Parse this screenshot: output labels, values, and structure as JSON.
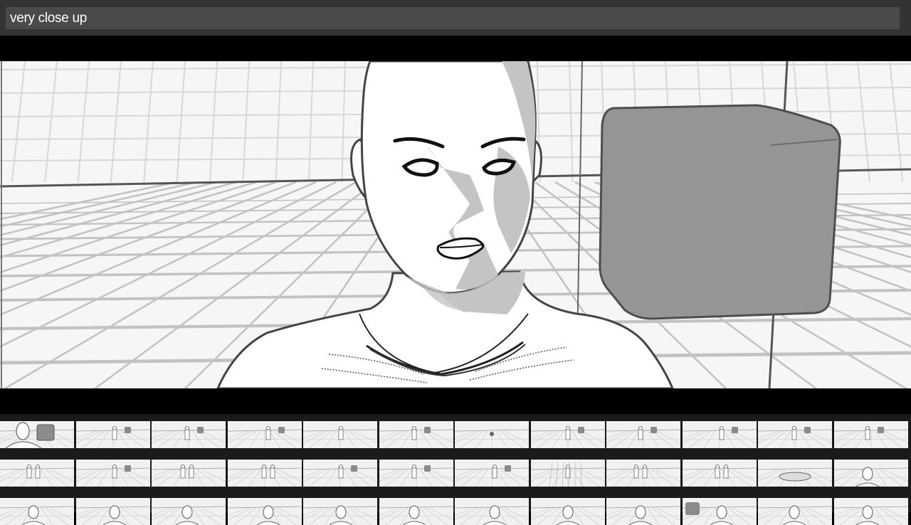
{
  "caption": {
    "value": "very close up",
    "placeholder": ""
  },
  "colors": {
    "toolbar_bg": "#333333",
    "input_bg": "#4a4a4a",
    "viewport_bg": "#f4f4f4",
    "letterbox": "#000000",
    "filmstrip_bg": "#1a1a1a",
    "shadow_gray": "#c4c4c4",
    "cube_gray": "#949494"
  },
  "viewport": {
    "subject": "bald-figure-close-up",
    "props": [
      "grey-cube",
      "perspective-grid-floor"
    ]
  },
  "filmstrip": {
    "rows": [
      [
        "close-up-figure-with-cube",
        "figure-with-cube",
        "figure-with-cube",
        "figure-with-cube",
        "figure-wide",
        "figure-with-cube",
        "figure-tiny-distant",
        "figure-with-cube",
        "figure-with-cube",
        "figure-with-cube",
        "figure-with-cube",
        "figure-with-cube"
      ],
      [
        "figure-group",
        "figure-with-cube",
        "figure-group",
        "figure-group",
        "figure-with-cube",
        "figure-with-cube",
        "figure-with-cube",
        "figure-grid",
        "figure-group",
        "figure-group",
        "figure-reclining",
        "head-close-up"
      ],
      [
        "head-shot",
        "head-shot",
        "head-shot",
        "head-shot",
        "head-shot",
        "head-shot",
        "head-shot",
        "head-shot",
        "head-shot",
        "head-with-cube",
        "head-shot",
        "head-shot"
      ]
    ],
    "selected_index": 0
  }
}
